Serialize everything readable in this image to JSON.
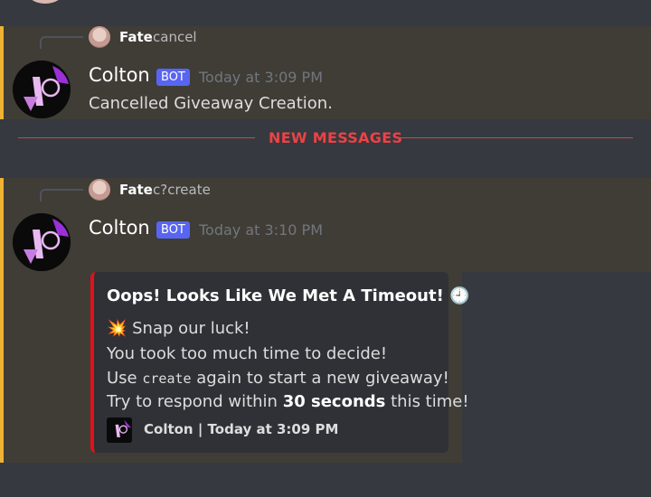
{
  "divider": {
    "label": "NEW MESSAGES"
  },
  "messages": [
    {
      "reply": {
        "name": "Fate",
        "text": "cancel"
      },
      "author": "Colton",
      "bot_tag": "BOT",
      "timestamp": "Today at 3:09 PM",
      "content": "Cancelled Giveaway Creation."
    },
    {
      "reply": {
        "name": "Fate",
        "text": "c?create"
      },
      "author": "Colton",
      "bot_tag": "BOT",
      "timestamp": "Today at 3:10 PM",
      "embed": {
        "title": "Oops! Looks Like We Met A Timeout! 🕘",
        "line1": "💥 Snap our luck!",
        "line2": "You took too much time to decide!",
        "line3_prefix": "Use ",
        "line3_code": "create",
        "line3_suffix": " again to start a new giveaway!",
        "line4_prefix": "Try to respond within ",
        "line4_bold": "30 seconds",
        "line4_suffix": " this time!",
        "footer": "Colton | Today at 3:09 PM",
        "accent_color": "#e3101a"
      }
    }
  ],
  "colors": {
    "background": "#36393f",
    "highlight": "#3f3d36",
    "mention_bar": "#f0b232",
    "bot_tag": "#5865f2",
    "new_messages": "#ed4245"
  }
}
